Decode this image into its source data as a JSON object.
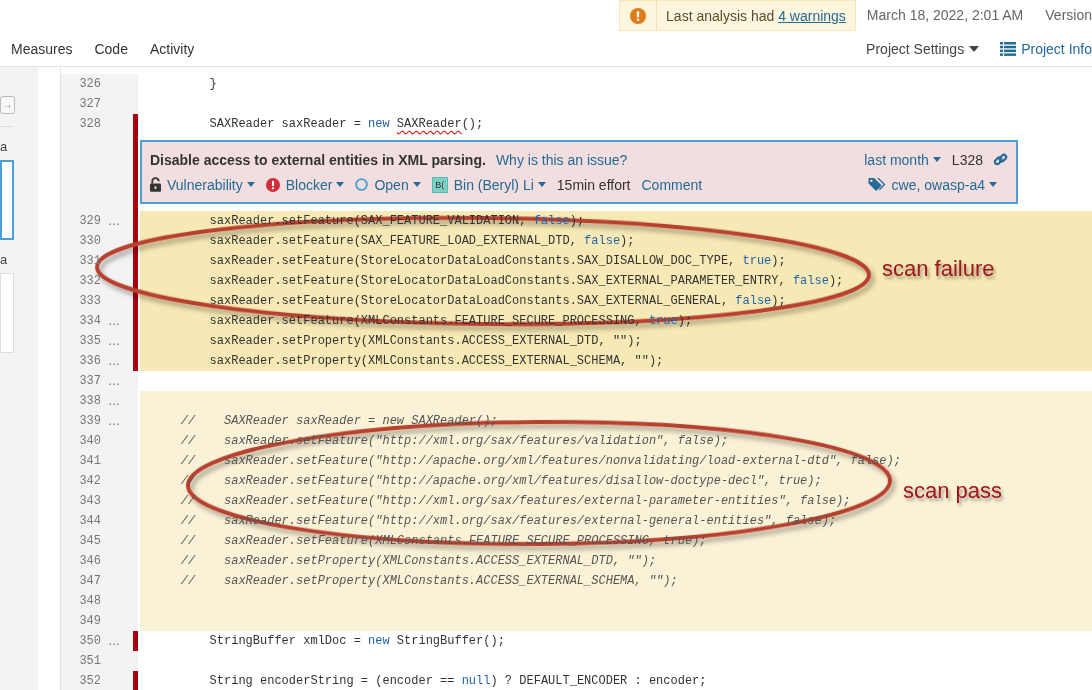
{
  "top_bar": {
    "warning": {
      "text": "Last analysis had ",
      "link": "4 warnings"
    },
    "date": "March 18, 2022, 2:01 AM",
    "version_label": "Version"
  },
  "nav": {
    "tabs": [
      {
        "label": "Measures",
        "selected": false
      },
      {
        "label": "Code",
        "selected": false
      },
      {
        "label": "Activity",
        "selected": false
      }
    ],
    "actions": [
      {
        "label": "Project Settings",
        "kind": "dropdown"
      },
      {
        "label": "Project Info",
        "kind": "info"
      }
    ]
  },
  "sidebar": {
    "items": [
      {
        "kind": "button",
        "text": "→"
      },
      {
        "kind": "rule"
      },
      {
        "kind": "label",
        "text": "a"
      },
      {
        "kind": "panel",
        "selected": true
      },
      {
        "kind": "label",
        "text": "a"
      },
      {
        "kind": "panel",
        "selected": false
      }
    ]
  },
  "code": {
    "lines": [
      {
        "kind": "code",
        "number": "326",
        "marker": false,
        "tokens": [
          {
            "kind": "plain",
            "text": "        }"
          }
        ]
      },
      {
        "kind": "code",
        "number": "327",
        "marker": false
      },
      {
        "kind": "code",
        "number": "328",
        "marker": true,
        "tokens": [
          {
            "kind": "plain",
            "text": "        SAXReader saxReader = "
          },
          {
            "kind": "keyword",
            "text": "new "
          },
          {
            "kind": "error",
            "text": "SAXReader"
          },
          {
            "kind": "plain",
            "text": "();"
          }
        ]
      },
      {
        "kind": "issue",
        "marker": true,
        "title": "Disable access to external entities in XML parsing.",
        "why_link": "Why is this an issue?",
        "age": "last month",
        "line_ref": "L328",
        "type": "Vulnerability",
        "severity": "Blocker",
        "status": "Open",
        "assignee_initials": "B(",
        "assignee": "Bin (Beryl) Li",
        "effort": "15min effort",
        "comment_link": "Comment",
        "tags": "cwe, owasp-a4"
      },
      {
        "kind": "code",
        "number": "329",
        "marker": true,
        "gutter_mark": "…",
        "color": "#f7e9b5",
        "tokens": [
          {
            "kind": "plain",
            "text": "        saxReader.setFeature(SAX_FEATURE_VALIDATION, "
          },
          {
            "kind": "keyword",
            "text": "false"
          },
          {
            "kind": "plain",
            "text": ");"
          }
        ]
      },
      {
        "kind": "code",
        "number": "330",
        "marker": true,
        "color": "#f7e9b5",
        "tokens": [
          {
            "kind": "plain",
            "text": "        saxReader.setFeature(SAX_FEATURE_LOAD_EXTERNAL_DTD, "
          },
          {
            "kind": "keyword",
            "text": "false"
          },
          {
            "kind": "plain",
            "text": ");"
          }
        ]
      },
      {
        "kind": "code",
        "number": "331",
        "marker": true,
        "color": "#f7e9b5",
        "tokens": [
          {
            "kind": "plain",
            "text": "        saxReader.setFeature(StoreLocatorDataLoadConstants.SAX_DISALLOW_DOC_TYPE, "
          },
          {
            "kind": "keyword",
            "text": "true"
          },
          {
            "kind": "plain",
            "text": ");"
          }
        ]
      },
      {
        "kind": "code",
        "number": "332",
        "marker": true,
        "color": "#f7e9b5",
        "tokens": [
          {
            "kind": "plain",
            "text": "        saxReader.setFeature(StoreLocatorDataLoadConstants.SAX_EXTERNAL_PARAMETER_ENTRY, "
          },
          {
            "kind": "keyword",
            "text": "false"
          },
          {
            "kind": "plain",
            "text": ");"
          }
        ]
      },
      {
        "kind": "code",
        "number": "333",
        "marker": true,
        "color": "#f7e9b5",
        "tokens": [
          {
            "kind": "plain",
            "text": "        saxReader.setFeature(StoreLocatorDataLoadConstants.SAX_EXTERNAL_GENERAL, "
          },
          {
            "kind": "keyword",
            "text": "false"
          },
          {
            "kind": "plain",
            "text": ");"
          }
        ]
      },
      {
        "kind": "code",
        "number": "334",
        "marker": true,
        "gutter_mark": "…",
        "color": "#f7e9b5",
        "tokens": [
          {
            "kind": "plain",
            "text": "        saxReader.setFeature(XMLConstants.FEATURE_SECURE_PROCESSING, "
          },
          {
            "kind": "keyword",
            "text": "true"
          },
          {
            "kind": "plain",
            "text": ");"
          }
        ]
      },
      {
        "kind": "code",
        "number": "335",
        "marker": true,
        "gutter_mark": "…",
        "color": "#f7e9b5",
        "tokens": [
          {
            "kind": "plain",
            "text": "        saxReader.setProperty(XMLConstants.ACCESS_EXTERNAL_DTD, \"\");"
          }
        ]
      },
      {
        "kind": "code",
        "number": "336",
        "marker": true,
        "gutter_mark": "…",
        "color": "#f7e9b5",
        "tokens": [
          {
            "kind": "plain",
            "text": "        saxReader.setProperty(XMLConstants.ACCESS_EXTERNAL_SCHEMA, \"\");"
          }
        ]
      },
      {
        "kind": "code",
        "number": "337",
        "marker": false,
        "gutter_mark": "…"
      },
      {
        "kind": "code",
        "number": "338",
        "marker": false,
        "gutter_mark": "…",
        "color": "#faf2d6"
      },
      {
        "kind": "comment",
        "number": "339",
        "marker": false,
        "gutter_mark": "…",
        "color": "#faf2d6",
        "tokens": [
          {
            "kind": "plain",
            "text": "    //    SAXReader saxReader = new SAXReader();"
          }
        ]
      },
      {
        "kind": "comment",
        "number": "340",
        "marker": false,
        "color": "#faf2d6",
        "tokens": [
          {
            "kind": "plain",
            "text": "    //    saxReader.setFeature(\"http://xml.org/sax/features/validation\", false);"
          }
        ]
      },
      {
        "kind": "comment",
        "number": "341",
        "marker": false,
        "color": "#faf2d6",
        "tokens": [
          {
            "kind": "plain",
            "text": "    //    saxReader.setFeature(\"http://apache.org/xml/features/nonvalidating/load-external-dtd\", false);"
          }
        ]
      },
      {
        "kind": "comment",
        "number": "342",
        "marker": false,
        "color": "#faf2d6",
        "tokens": [
          {
            "kind": "plain",
            "text": "    //    saxReader.setFeature(\"http://apache.org/xml/features/disallow-doctype-decl\", true);"
          }
        ]
      },
      {
        "kind": "comment",
        "number": "343",
        "marker": false,
        "color": "#faf2d6",
        "tokens": [
          {
            "kind": "plain",
            "text": "    //    saxReader.setFeature(\"http://xml.org/sax/features/external-parameter-entities\", false);"
          }
        ]
      },
      {
        "kind": "comment",
        "number": "344",
        "marker": false,
        "color": "#faf2d6",
        "tokens": [
          {
            "kind": "plain",
            "text": "    //    saxReader.setFeature(\"http://xml.org/sax/features/external-general-entities\", false);"
          }
        ]
      },
      {
        "kind": "comment",
        "number": "345",
        "marker": false,
        "color": "#faf2d6",
        "tokens": [
          {
            "kind": "plain",
            "text": "    //    saxReader.setFeature(XMLConstants.FEATURE_SECURE_PROCESSING, true);"
          }
        ]
      },
      {
        "kind": "comment",
        "number": "346",
        "marker": false,
        "color": "#faf2d6",
        "tokens": [
          {
            "kind": "plain",
            "text": "    //    saxReader.setProperty(XMLConstants.ACCESS_EXTERNAL_DTD, \"\");"
          }
        ]
      },
      {
        "kind": "comment",
        "number": "347",
        "marker": false,
        "color": "#faf2d6",
        "tokens": [
          {
            "kind": "plain",
            "text": "    //    saxReader.setProperty(XMLConstants.ACCESS_EXTERNAL_SCHEMA, \"\");"
          }
        ]
      },
      {
        "kind": "code",
        "number": "348",
        "marker": false,
        "color": "#faf2d6"
      },
      {
        "kind": "code",
        "number": "349",
        "marker": false,
        "color": "#faf2d6"
      },
      {
        "kind": "code",
        "number": "350",
        "marker": true,
        "gutter_mark": "…",
        "tokens": [
          {
            "kind": "plain",
            "text": "        StringBuffer xmlDoc = "
          },
          {
            "kind": "keyword",
            "text": "new"
          },
          {
            "kind": "plain",
            "text": " StringBuffer();"
          }
        ]
      },
      {
        "kind": "code",
        "number": "351",
        "marker": false
      },
      {
        "kind": "code",
        "number": "352",
        "marker": true,
        "tokens": [
          {
            "kind": "plain",
            "text": "        String encoderString = (encoder == "
          },
          {
            "kind": "keyword",
            "text": "null"
          },
          {
            "kind": "plain",
            "text": ") ? DEFAULT_ENCODER : encoder;"
          }
        ]
      }
    ]
  },
  "annotations": [
    {
      "label": "scan failure"
    },
    {
      "label": "scan pass"
    }
  ]
}
